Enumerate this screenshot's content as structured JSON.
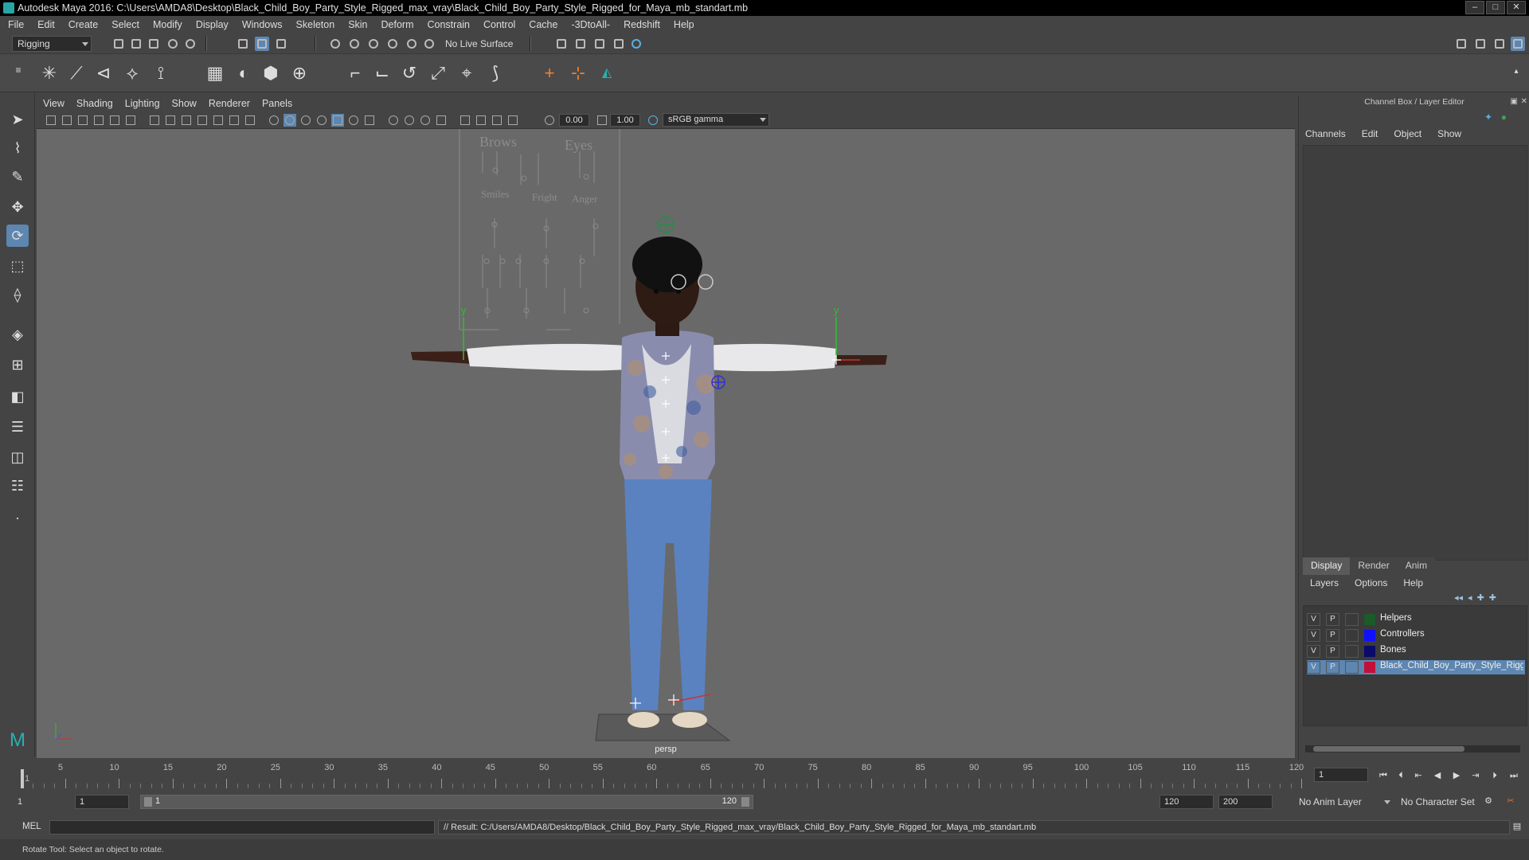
{
  "window": {
    "title": "Autodesk Maya 2016: C:\\Users\\AMDA8\\Desktop\\Black_Child_Boy_Party_Style_Rigged_max_vray\\Black_Child_Boy_Party_Style_Rigged_for_Maya_mb_standart.mb"
  },
  "menubar": [
    "File",
    "Edit",
    "Create",
    "Select",
    "Modify",
    "Display",
    "Windows",
    "Skeleton",
    "Skin",
    "Deform",
    "Constrain",
    "Control",
    "Cache",
    "-3DtoAll-",
    "Redshift",
    "Help"
  ],
  "shelf": {
    "menuset": "Rigging",
    "live_surface": "No Live Surface"
  },
  "viewport": {
    "menu": [
      "View",
      "Shading",
      "Lighting",
      "Show",
      "Renderer",
      "Panels"
    ],
    "exposure": "0.00",
    "gamma": "1.00",
    "color_space": "sRGB gamma",
    "camera_label": "persp",
    "axis_y": "y",
    "face_gui": {
      "brows": "Brows",
      "eyes": "Eyes",
      "smiles": "Smiles",
      "fright": "Fright",
      "anger": "Anger"
    }
  },
  "channel_box": {
    "title": "Channel Box / Layer Editor",
    "menu": [
      "Channels",
      "Edit",
      "Object",
      "Show"
    ]
  },
  "layer_editor": {
    "tabs": [
      "Display",
      "Render",
      "Anim"
    ],
    "menu": [
      "Layers",
      "Options",
      "Help"
    ],
    "layers": [
      {
        "v": "V",
        "p": "P",
        "name": "Helpers",
        "color": "#1c5a2a"
      },
      {
        "v": "V",
        "p": "P",
        "name": "Controllers",
        "color": "#1010ff"
      },
      {
        "v": "V",
        "p": "P",
        "name": "Bones",
        "color": "#0a0a6a"
      },
      {
        "v": "V",
        "p": "P",
        "name": "Black_Child_Boy_Party_Style_Rigged",
        "color": "#c0103a"
      }
    ]
  },
  "timeline": {
    "labels": [
      "5",
      "10",
      "15",
      "20",
      "25",
      "30",
      "35",
      "40",
      "45",
      "50",
      "55",
      "60",
      "65",
      "70",
      "75",
      "80",
      "85",
      "90",
      "95",
      "100",
      "105",
      "110",
      "115",
      "120"
    ],
    "label_first": "1",
    "current_frame": "1"
  },
  "range": {
    "start": "1",
    "anim_start": "1",
    "slider_start": "1",
    "slider_end": "120",
    "end": "120",
    "anim_end": "200",
    "anim_layer": "No Anim Layer",
    "char_set": "No Character Set"
  },
  "cmd": {
    "lang": "MEL",
    "result": "// Result: C:/Users/AMDA8/Desktop/Black_Child_Boy_Party_Style_Rigged_max_vray/Black_Child_Boy_Party_Style_Rigged_for_Maya_mb_standart.mb"
  },
  "status": "Rotate Tool: Select an object to rotate."
}
